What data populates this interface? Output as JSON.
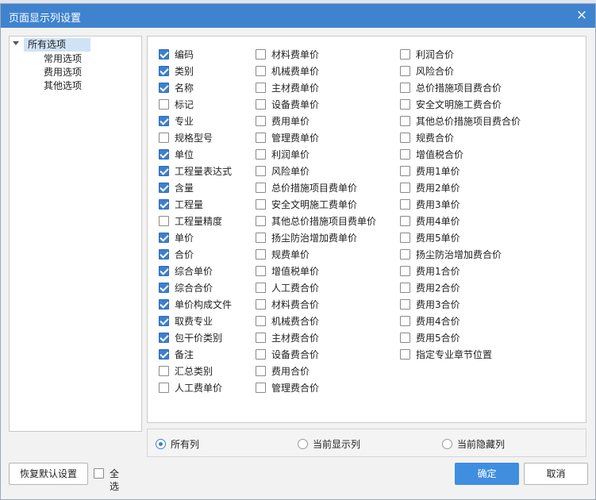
{
  "dialog": {
    "title": "页面显示列设置",
    "close_icon": "×"
  },
  "tree": {
    "root": "所有选项",
    "children": [
      "常用选项",
      "费用选项",
      "其他选项"
    ]
  },
  "columns": [
    [
      {
        "label": "编码",
        "checked": true
      },
      {
        "label": "类别",
        "checked": true
      },
      {
        "label": "名称",
        "checked": true
      },
      {
        "label": "标记",
        "checked": false
      },
      {
        "label": "专业",
        "checked": true
      },
      {
        "label": "规格型号",
        "checked": false
      },
      {
        "label": "单位",
        "checked": true
      },
      {
        "label": "工程量表达式",
        "checked": true
      },
      {
        "label": "含量",
        "checked": true
      },
      {
        "label": "工程量",
        "checked": true
      },
      {
        "label": "工程量精度",
        "checked": false
      },
      {
        "label": "单价",
        "checked": true
      },
      {
        "label": "合价",
        "checked": true
      },
      {
        "label": "综合单价",
        "checked": true
      },
      {
        "label": "综合合价",
        "checked": true
      },
      {
        "label": "单价构成文件",
        "checked": true
      },
      {
        "label": "取费专业",
        "checked": true
      },
      {
        "label": "包干价类别",
        "checked": true
      },
      {
        "label": "备注",
        "checked": true
      },
      {
        "label": "汇总类别",
        "checked": false
      },
      {
        "label": "人工费单价",
        "checked": false
      }
    ],
    [
      {
        "label": "材料费单价",
        "checked": false
      },
      {
        "label": "机械费单价",
        "checked": false
      },
      {
        "label": "主材费单价",
        "checked": false
      },
      {
        "label": "设备费单价",
        "checked": false
      },
      {
        "label": "费用单价",
        "checked": false
      },
      {
        "label": "管理费单价",
        "checked": false
      },
      {
        "label": "利润单价",
        "checked": false
      },
      {
        "label": "风险单价",
        "checked": false
      },
      {
        "label": "总价措施项目费单价",
        "checked": false
      },
      {
        "label": "安全文明施工费单价",
        "checked": false
      },
      {
        "label": "其他总价措施项目费单价",
        "checked": false
      },
      {
        "label": "扬尘防治增加费单价",
        "checked": false
      },
      {
        "label": "规费单价",
        "checked": false
      },
      {
        "label": "增值税单价",
        "checked": false
      },
      {
        "label": "人工费合价",
        "checked": false
      },
      {
        "label": "材料费合价",
        "checked": false
      },
      {
        "label": "机械费合价",
        "checked": false
      },
      {
        "label": "主材费合价",
        "checked": false
      },
      {
        "label": "设备费合价",
        "checked": false
      },
      {
        "label": "费用合价",
        "checked": false
      },
      {
        "label": "管理费合价",
        "checked": false
      }
    ],
    [
      {
        "label": "利润合价",
        "checked": false
      },
      {
        "label": "风险合价",
        "checked": false
      },
      {
        "label": "总价措施项目费合价",
        "checked": false
      },
      {
        "label": "安全文明施工费合价",
        "checked": false
      },
      {
        "label": "其他总价措施项目费合价",
        "checked": false
      },
      {
        "label": "规费合价",
        "checked": false
      },
      {
        "label": "增值税合价",
        "checked": false
      },
      {
        "label": "费用1单价",
        "checked": false
      },
      {
        "label": "费用2单价",
        "checked": false
      },
      {
        "label": "费用3单价",
        "checked": false
      },
      {
        "label": "费用4单价",
        "checked": false
      },
      {
        "label": "费用5单价",
        "checked": false
      },
      {
        "label": "扬尘防治增加费合价",
        "checked": false
      },
      {
        "label": "费用1合价",
        "checked": false
      },
      {
        "label": "费用2合价",
        "checked": false
      },
      {
        "label": "费用3合价",
        "checked": false
      },
      {
        "label": "费用4合价",
        "checked": false
      },
      {
        "label": "费用5合价",
        "checked": false
      },
      {
        "label": "指定专业章节位置",
        "checked": false
      }
    ]
  ],
  "radios": [
    {
      "label": "所有列",
      "selected": true
    },
    {
      "label": "当前显示列",
      "selected": false
    },
    {
      "label": "当前隐藏列",
      "selected": false
    }
  ],
  "footer": {
    "restore_label": "恢复默认设置",
    "select_all_label": "全选",
    "select_all_checked": false,
    "ok_label": "确定",
    "cancel_label": "取消"
  },
  "colors": {
    "titlebar": "#3f83cf",
    "accent": "#3d7fd0",
    "primary_button": "#3f8ee0"
  }
}
